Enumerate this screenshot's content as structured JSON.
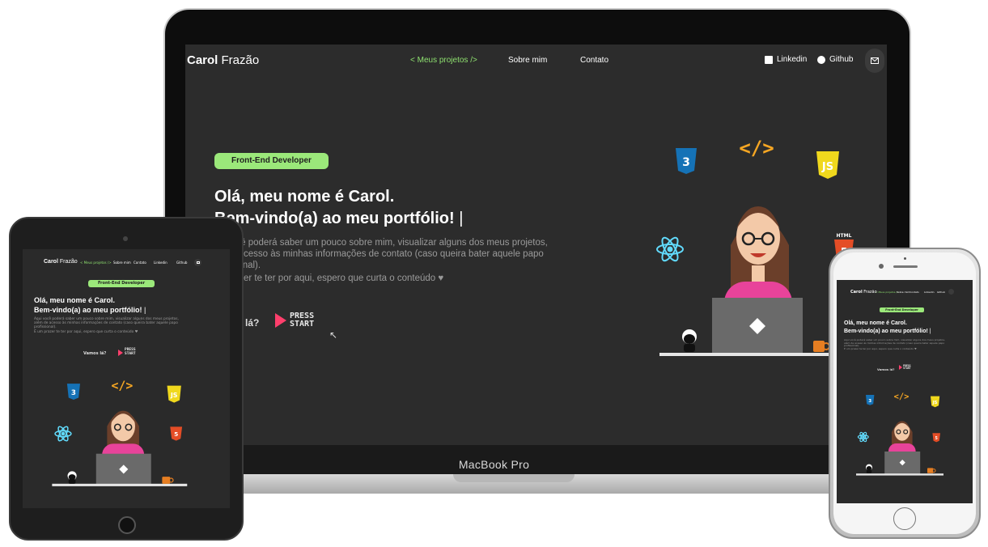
{
  "brand": {
    "first": "Carol",
    "last": "Frazão"
  },
  "nav": {
    "projects": "< Meus projetos />",
    "about": "Sobre mim",
    "contact": "Contato"
  },
  "social": {
    "linkedin": "Linkedin",
    "github": "Github"
  },
  "hero": {
    "badge": "Front-End Developer",
    "title_line1": "Olá, meu nome é Carol.",
    "title_line2": "Bem-vindo(a) ao meu portfólio!",
    "cursor": "|",
    "desc_line1": "Aqui você poderá saber um pouco sobre mim, visualizar alguns dos meus projetos,",
    "desc_line2": "além de acesso às minhas informações de contato (caso queira bater aquele papo",
    "desc_line3": "profissional).",
    "desc_line4": "É um prazer te ter por aqui, espero que curta o conteúdo ♥",
    "cta": "Vamos lá?",
    "press_line1": "PRESS",
    "press_line2": "START"
  },
  "mac_visible": {
    "desc_line1": "ocê poderá saber um pouco sobre mim, visualizar alguns dos meus projetos,",
    "desc_line2": "e acesso às minhas informações de contato (caso queira bater aquele papo",
    "desc_line3": "sional).",
    "desc_line4": "razer te ter por aqui, espero que curta o conteúdo ♥",
    "cta": "s lá?"
  },
  "tech_icons": {
    "css": "3",
    "code": "</>",
    "js": "JS",
    "html": "HTML",
    "html_num": "5"
  },
  "device_label": "MacBook Pro",
  "colors": {
    "background": "#2b2b2b",
    "accent_green": "#8ee06f",
    "badge_green": "#9be87a",
    "press_pink": "#ff3f6c",
    "css_blue": "#1572b6",
    "js_yellow": "#f0d81d",
    "html_orange": "#e44d26",
    "react_cyan": "#61dafb",
    "code_orange": "#f5a623",
    "hoodie_pink": "#e8439a"
  }
}
